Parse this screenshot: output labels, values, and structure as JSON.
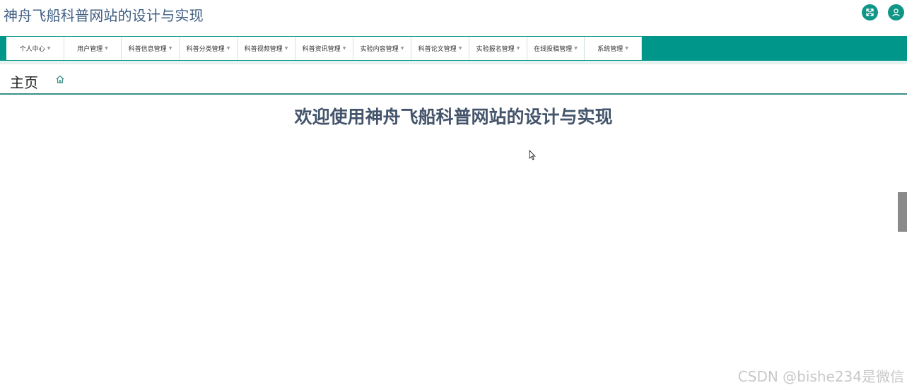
{
  "header": {
    "title": "神舟飞船科普网站的设计与实现",
    "fullscreen_icon": "fullscreen-icon",
    "user_icon": "user-icon",
    "accent_color": "#01968a"
  },
  "nav": {
    "items": [
      {
        "label": "个人中心"
      },
      {
        "label": "用户管理"
      },
      {
        "label": "科普信息管理"
      },
      {
        "label": "科普分类管理"
      },
      {
        "label": "科普视频管理"
      },
      {
        "label": "科普资讯管理"
      },
      {
        "label": "实验内容管理"
      },
      {
        "label": "科普论文管理"
      },
      {
        "label": "实验报名管理"
      },
      {
        "label": "在线投稿管理"
      },
      {
        "label": "系统管理"
      }
    ]
  },
  "breadcrumb": {
    "title": "主页",
    "home_icon": "home-icon"
  },
  "main": {
    "welcome": "欢迎使用神舟飞船科普网站的设计与实现"
  },
  "watermark": "CSDN @bishe234是微信"
}
